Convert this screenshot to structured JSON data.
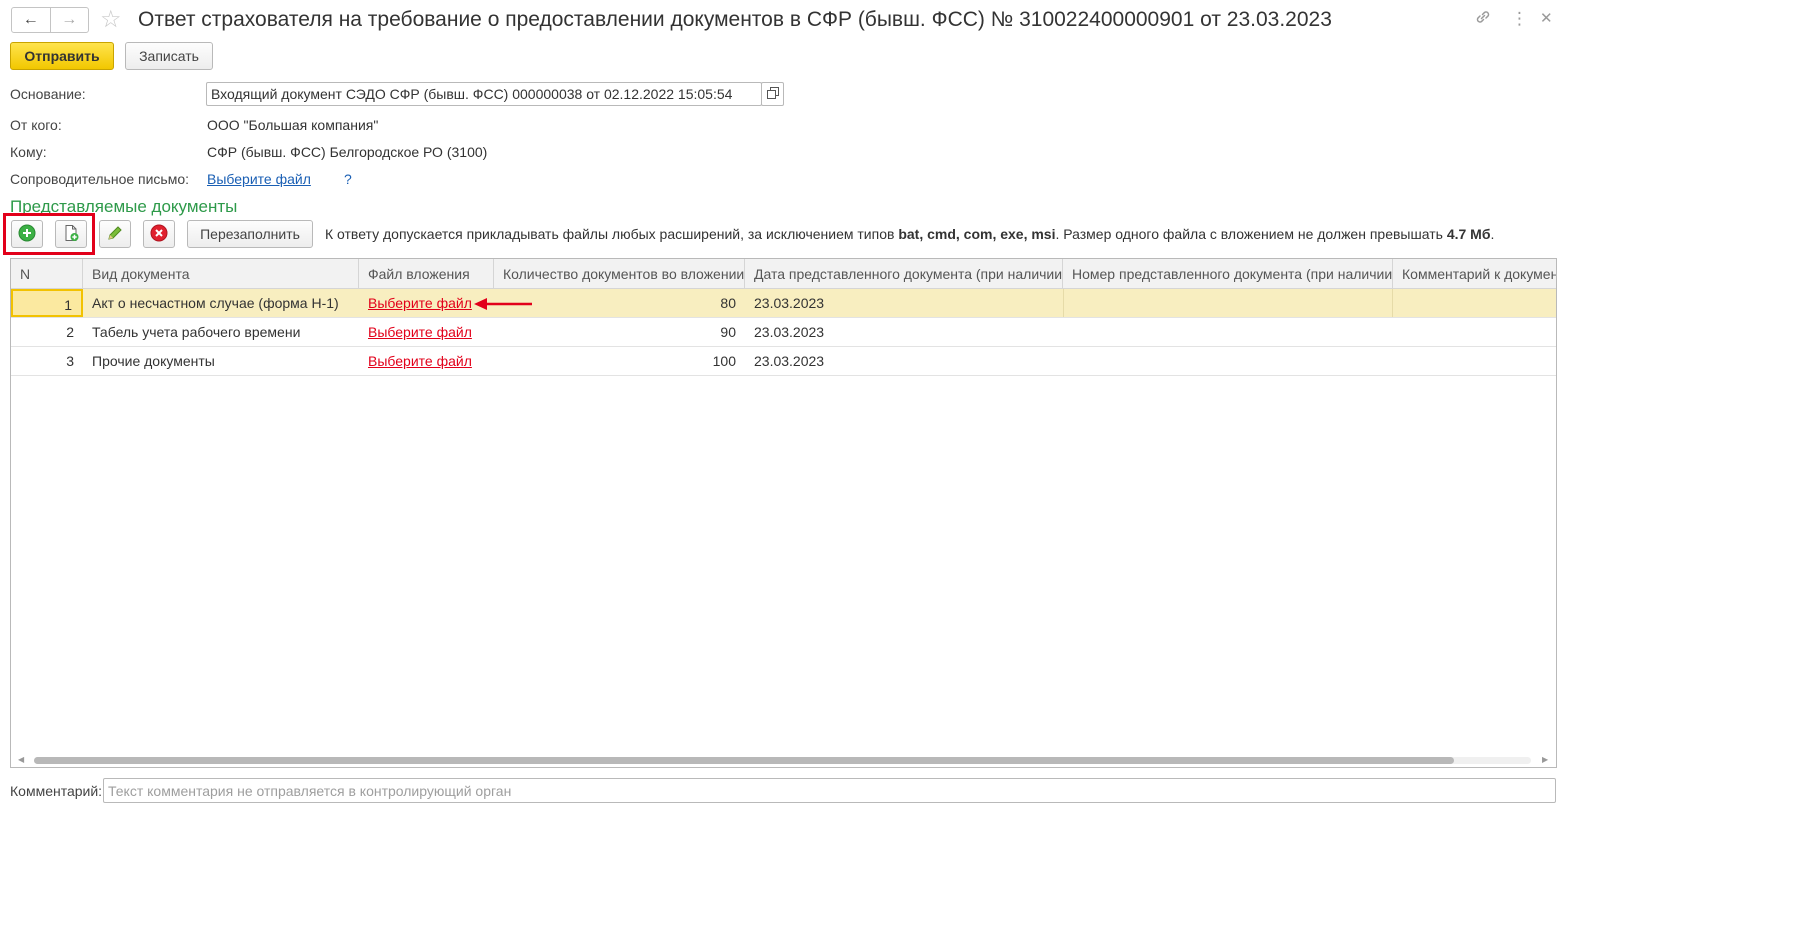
{
  "header": {
    "back": "←",
    "forward": "→",
    "star": "☆",
    "title": "Ответ страхователя на требование о предоставлении документов в СФР (бывш. ФСС) № 310022400000901 от 23.03.2023",
    "link_icon": "🔗",
    "more_icon": "⋮",
    "close_icon": "✕"
  },
  "commands": {
    "send_label": "Отправить",
    "save_label": "Записать"
  },
  "fields": {
    "basis_label": "Основание:",
    "basis_value": "Входящий документ СЭДО СФР (бывш. ФСС) 000000038 от 02.12.2022 15:05:54",
    "from_label": "От кого:",
    "from_value": "ООО \"Большая компания\"",
    "to_label": "Кому:",
    "to_value": "СФР (бывш. ФСС) Белгородское РО (3100)",
    "letter_label": "Сопроводительное письмо:",
    "letter_link": "Выберите файл",
    "letter_help": "?"
  },
  "documents": {
    "section_title": "Представляемые документы",
    "refill_label": "Перезаполнить",
    "info_text_1": "К ответу допускается прикладывать файлы любых расширений, за исключением типов ",
    "info_types": "bat, cmd, com, exe, msi",
    "info_text_2": ". Размер одного файла с вложением не должен превышать ",
    "info_size": "4.7 Мб",
    "info_text_3": ".",
    "columns": [
      "N",
      "Вид документа",
      "Файл вложения",
      "Количество документов во вложении",
      "Дата представленного документа (при наличии)",
      "Номер представленного документа (при наличии)",
      "Комментарий к документу"
    ],
    "rows": [
      {
        "n": "1",
        "type": "Акт о несчастном случае (форма Н-1)",
        "file": "Выберите файл",
        "count": "80",
        "date": "23.03.2023",
        "number": "",
        "comment": ""
      },
      {
        "n": "2",
        "type": "Табель учета рабочего времени",
        "file": "Выберите файл",
        "count": "90",
        "date": "23.03.2023",
        "number": "",
        "comment": ""
      },
      {
        "n": "3",
        "type": "Прочие документы",
        "file": "Выберите файл",
        "count": "100",
        "date": "23.03.2023",
        "number": "",
        "comment": ""
      }
    ]
  },
  "comment": {
    "label": "Комментарий:",
    "placeholder": "Текст комментария не отправляется в контролирующий орган"
  },
  "colors": {
    "primary_button": "#f2c700",
    "section_title": "#2e9a4a",
    "link_blue": "#1a5fb4",
    "link_red": "#e2001a",
    "selected_row": "#f8eec0",
    "highlight_frame": "#e2001a"
  }
}
